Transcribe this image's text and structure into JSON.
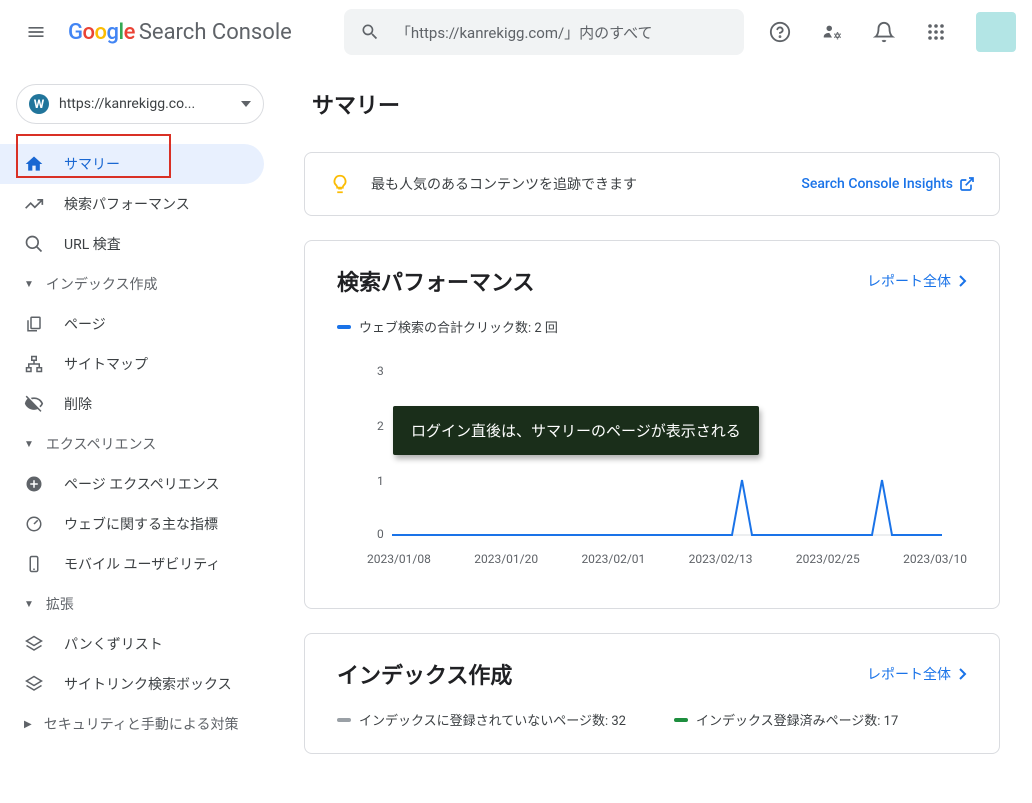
{
  "header": {
    "product": "Search Console",
    "search_placeholder": "「https://kanrekigg.com/」内のすべて",
    "property": "https://kanrekigg.co..."
  },
  "sidebar": {
    "items": [
      {
        "label": "サマリー"
      },
      {
        "label": "検索パフォーマンス"
      },
      {
        "label": "URL 検査"
      }
    ],
    "sections": [
      {
        "title": "インデックス作成",
        "items": [
          {
            "label": "ページ"
          },
          {
            "label": "サイトマップ"
          },
          {
            "label": "削除"
          }
        ]
      },
      {
        "title": "エクスペリエンス",
        "items": [
          {
            "label": "ページ エクスペリエンス"
          },
          {
            "label": "ウェブに関する主な指標"
          },
          {
            "label": "モバイル ユーザビリティ"
          }
        ]
      },
      {
        "title": "拡張",
        "items": [
          {
            "label": "パンくずリスト"
          },
          {
            "label": "サイトリンク検索ボックス"
          }
        ]
      },
      {
        "title": "セキュリティと手動による対策",
        "items": []
      }
    ]
  },
  "main": {
    "page_title": "サマリー",
    "insights": {
      "text": "最も人気のあるコンテンツを追跡できます",
      "link": "Search Console Insights"
    },
    "report_link": "レポート全体",
    "performance": {
      "title": "検索パフォーマンス",
      "legend": "ウェブ検索の合計クリック数: 2 回"
    },
    "annotation": "ログイン直後は、サマリーのページが表示される",
    "indexing": {
      "title": "インデックス作成",
      "not_indexed": "インデックスに登録されていないページ数: 32",
      "indexed": "インデックス登録済みページ数: 17"
    }
  },
  "chart_data": {
    "type": "line",
    "title": "検索パフォーマンス",
    "ylabel": "",
    "xlabel": "",
    "ylim": [
      0,
      3
    ],
    "x_ticks": [
      "2023/01/08",
      "2023/01/20",
      "2023/02/01",
      "2023/02/13",
      "2023/02/25",
      "2023/03/10"
    ],
    "series": [
      {
        "name": "ウェブ検索の合計クリック数",
        "color": "#1a73e8",
        "x": [
          "2023/01/08",
          "2023/01/20",
          "2023/02/01",
          "2023/02/13",
          "2023/02/17",
          "2023/02/18",
          "2023/02/19",
          "2023/02/25",
          "2023/03/07",
          "2023/03/08",
          "2023/03/09",
          "2023/03/10"
        ],
        "values": [
          0,
          0,
          0,
          0,
          0,
          1,
          0,
          0,
          0,
          1,
          0,
          0
        ]
      }
    ]
  }
}
